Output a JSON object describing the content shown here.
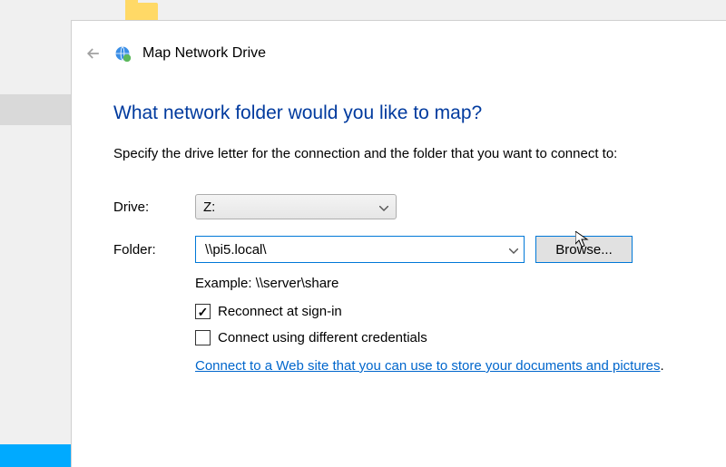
{
  "dialog": {
    "title": "Map Network Drive",
    "heading": "What network folder would you like to map?",
    "instruction": "Specify the drive letter for the connection and the folder that you want to connect to:",
    "drive_label": "Drive:",
    "drive_value": "Z:",
    "folder_label": "Folder:",
    "folder_value": "\\\\pi5.local\\",
    "browse_label": "Browse...",
    "example_text": "Example: \\\\server\\share",
    "checkbox_reconnect": {
      "label": "Reconnect at sign-in",
      "checked": true
    },
    "checkbox_credentials": {
      "label": "Connect using different credentials",
      "checked": false
    },
    "link_text": "Connect to a Web site that you can use to store your documents and pictures"
  }
}
